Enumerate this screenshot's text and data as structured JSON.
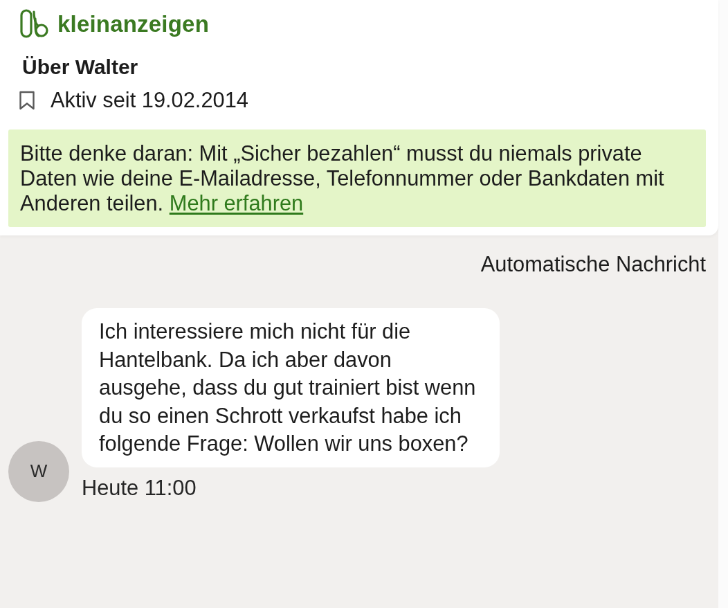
{
  "header": {
    "logo_text": "kleinanzeigen"
  },
  "profile": {
    "title": "Über Walter",
    "active_since": "Aktiv seit 19.02.2014"
  },
  "notice": {
    "text": "Bitte denke daran: Mit „Sicher bezahlen“ musst du niemals private Daten wie deine E-Mailadresse, Telefonnummer oder Bankdaten mit Anderen teilen.",
    "link": "Mehr erfahren"
  },
  "chat": {
    "label": "Automatische Nachricht",
    "messages": [
      {
        "avatar": "W",
        "text": "Ich interessiere mich nicht für die Hantelbank. Da ich aber davon ausgehe, dass du gut trainiert bist wenn du so einen Schrott verkaufst habe ich folgende Frage: Wollen wir uns boxen?",
        "time": "Heute 11:00"
      }
    ]
  }
}
